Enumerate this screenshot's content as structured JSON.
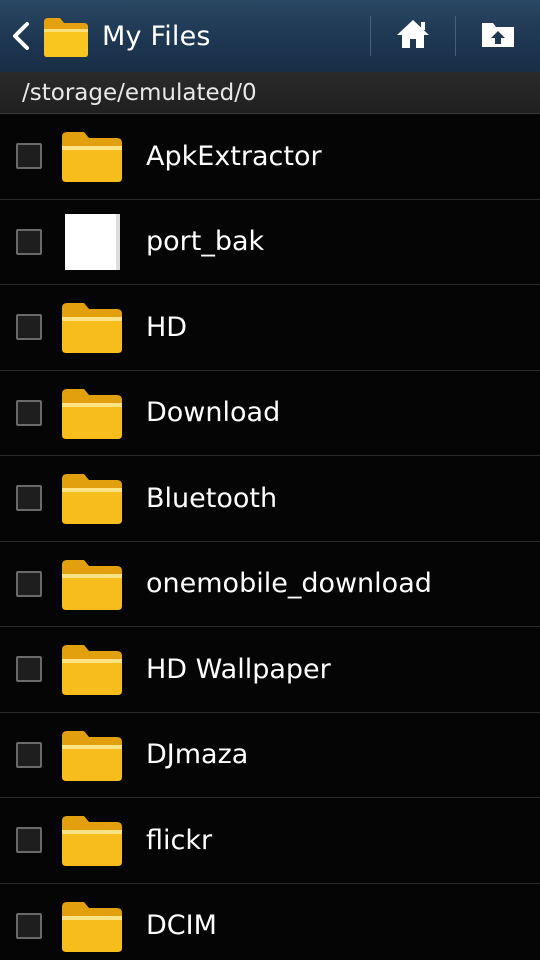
{
  "header": {
    "title": "My Files",
    "back_icon": "chevron-left-icon",
    "app_icon": "folder-icon",
    "home_icon": "home-icon",
    "up_icon": "folder-up-icon"
  },
  "path": "/storage/emulated/0",
  "colors": {
    "folder": "#f7bd1c",
    "action_bar": "#1e3752"
  },
  "files": [
    {
      "name": "ApkExtractor",
      "type": "folder",
      "checked": false
    },
    {
      "name": "port_bak",
      "type": "file",
      "checked": false
    },
    {
      "name": "HD",
      "type": "folder",
      "checked": false
    },
    {
      "name": "Download",
      "type": "folder",
      "checked": false
    },
    {
      "name": "Bluetooth",
      "type": "folder",
      "checked": false
    },
    {
      "name": "onemobile_download",
      "type": "folder",
      "checked": false
    },
    {
      "name": "HD Wallpaper",
      "type": "folder",
      "checked": false
    },
    {
      "name": "DJmaza",
      "type": "folder",
      "checked": false
    },
    {
      "name": "flickr",
      "type": "folder",
      "checked": false
    },
    {
      "name": "DCIM",
      "type": "folder",
      "checked": false
    }
  ]
}
